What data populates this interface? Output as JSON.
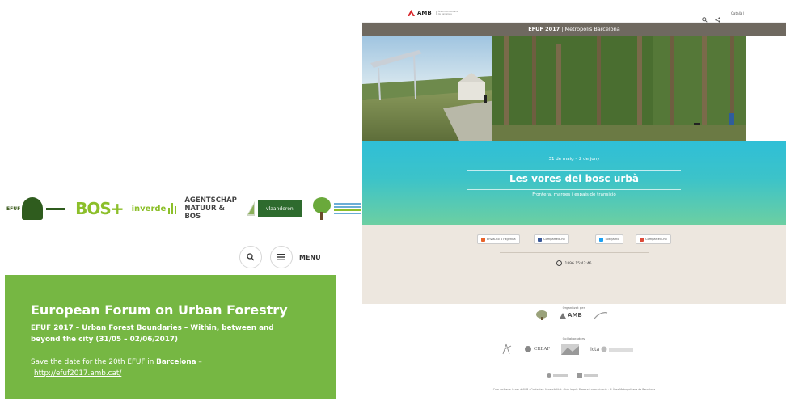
{
  "left": {
    "logos": {
      "efuf": "EFUF",
      "bos": "BOS",
      "bos_plus": "+",
      "inverde": "inverde",
      "agentschap_line1": "AGENTSCHAP",
      "agentschap_line2": "NATUUR & BOS",
      "green_badge": "vlaanderen"
    },
    "controls": {
      "search_icon": "search-icon",
      "menu_icon": "hamburger-icon",
      "menu_label": "MENU"
    },
    "banner": {
      "title": "European Forum on Urban Forestry",
      "subtitle": "EFUF 2017 – Urban Forest Boundaries – Within, between and beyond the city (31/05 – 02/06/2017)",
      "save_prefix": "Save the date for the 20th EFUF in ",
      "save_city": "Barcelona",
      "save_suffix": " –",
      "link": "http://efuf2017.amb.cat/"
    }
  },
  "right": {
    "header": {
      "logo": "AMB",
      "logo_sub": "Àrea Metropolitana de Barcelona",
      "lang": "Català",
      "lang_chevron": "|",
      "search_icon": "search-icon",
      "share_icon": "share-icon"
    },
    "greybar": {
      "event": "EFUF 2017",
      "sep": " | ",
      "place": "Metròpolis Barcelona"
    },
    "hero": {
      "date": "31 de maig – 2 de juny",
      "title": "Les vores del bosc urbà",
      "subtitle": "Frontera, marges i espais de transició"
    },
    "share": {
      "buttons": [
        "Envia-ho a l'agenda",
        "Comparteix-ho",
        "Tuiteja-ho",
        "Comparteix-ho"
      ],
      "colors": [
        "#e8632a",
        "#3b5998",
        "#1da1f2",
        "#dd4b39"
      ]
    },
    "countdown": "1896 15:43:46",
    "sponsors": {
      "organized_label": "Organitzat per:",
      "org_logos": [
        "AMB"
      ],
      "collab_label": "Col·laboradors:",
      "collab_logos": [
        "CREAF",
        "icta"
      ],
      "footer": "Com arribar a la seu d'AMB · Contacte · Accessibilitat · Avis legal · Premsa i comunicació · © Àrea Metropolitana de Barcelona"
    }
  }
}
